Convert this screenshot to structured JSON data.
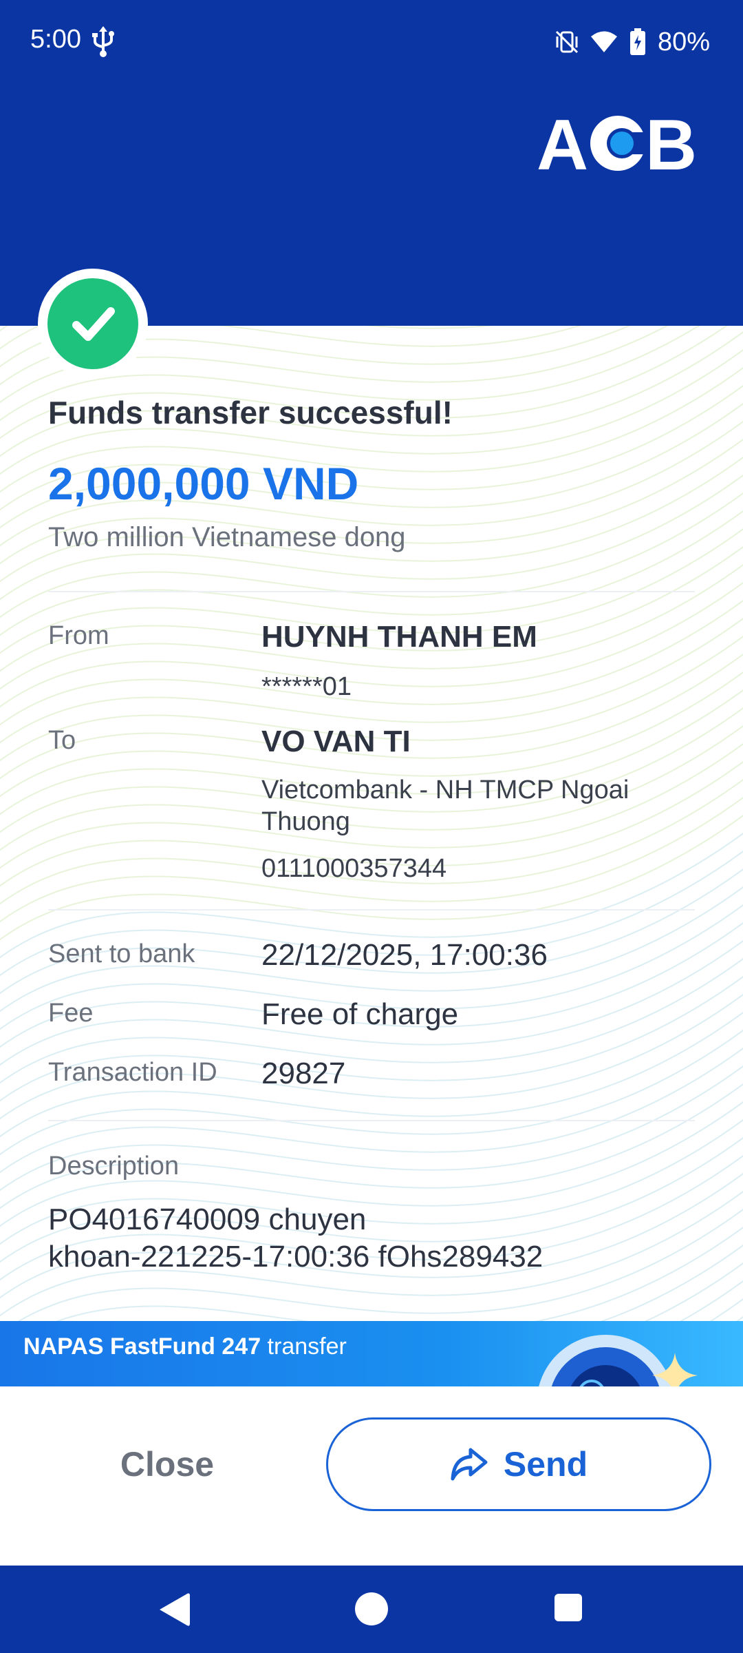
{
  "status_bar": {
    "time": "5:00",
    "battery": "80%",
    "icons": [
      "usb-icon",
      "vibrate-off-icon",
      "wifi-icon",
      "battery-charging-icon"
    ]
  },
  "header": {
    "logo_text": "ACB",
    "background_color": "#0a35a3"
  },
  "receipt": {
    "title": "Funds transfer successful!",
    "amount": "2,000,000 VND",
    "amount_in_words": "Two million Vietnamese dong",
    "from_label": "From",
    "from_name": "HUYNH THANH EM",
    "from_account": "******01",
    "to_label": "To",
    "to_name": "VO VAN TI",
    "to_bank_line1": "Vietcombank - NH TMCP Ngoai",
    "to_bank_line2": "Thuong",
    "to_account": "0111000357344",
    "sent_label": "Sent to bank",
    "sent_value": "22/12/2025, 17:00:36",
    "fee_label": "Fee",
    "fee_value": "Free of charge",
    "txn_label": "Transaction ID",
    "txn_value": "29827",
    "description_label": "Description",
    "description_line1": "PO4016740009 chuyen",
    "description_line2": "khoan-221225-17:00:36 fOhs289432",
    "accent_color": "#1a73e8",
    "success_color": "#1fc27c"
  },
  "promo": {
    "bold_text": "NAPAS FastFund 247",
    "rest_text": " transfer"
  },
  "actions": {
    "close_label": "Close",
    "send_label": "Send"
  },
  "nav": {
    "icons": [
      "back-icon",
      "home-icon",
      "recents-icon"
    ]
  }
}
